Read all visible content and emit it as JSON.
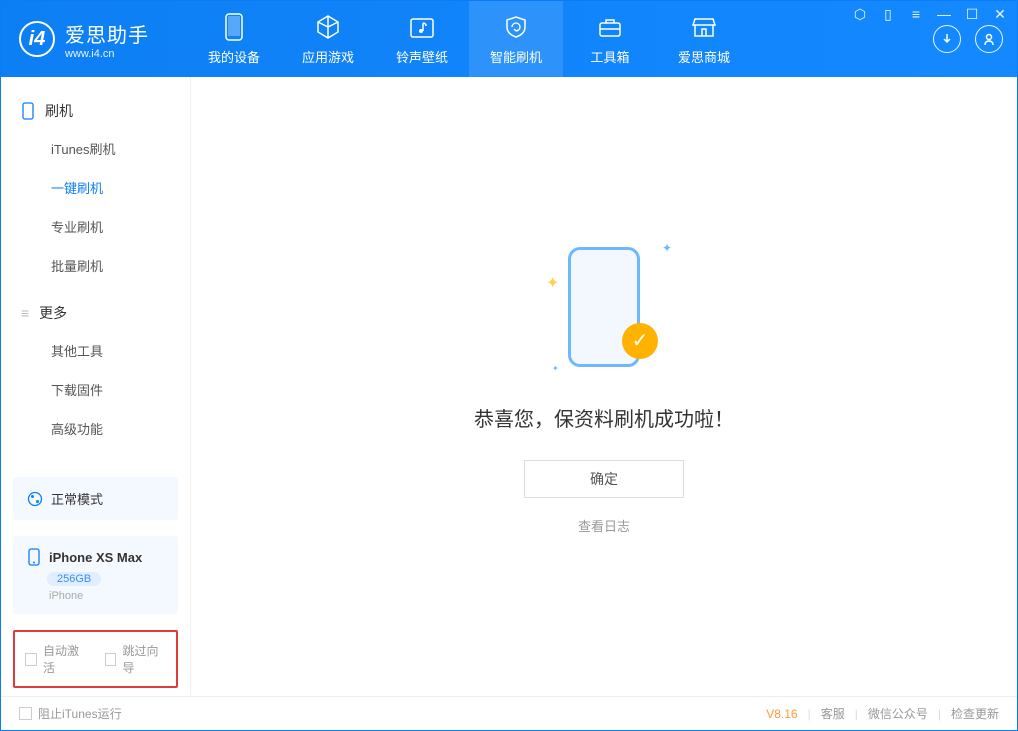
{
  "app": {
    "title": "爱思助手",
    "subtitle": "www.i4.cn"
  },
  "nav": [
    {
      "label": "我的设备"
    },
    {
      "label": "应用游戏"
    },
    {
      "label": "铃声壁纸"
    },
    {
      "label": "智能刷机"
    },
    {
      "label": "工具箱"
    },
    {
      "label": "爱思商城"
    }
  ],
  "sidebar": {
    "group1": {
      "title": "刷机",
      "items": [
        "iTunes刷机",
        "一键刷机",
        "专业刷机",
        "批量刷机"
      ]
    },
    "group2": {
      "title": "更多",
      "items": [
        "其他工具",
        "下载固件",
        "高级功能"
      ]
    }
  },
  "device": {
    "mode": "正常模式",
    "name": "iPhone XS Max",
    "capacity": "256GB",
    "type": "iPhone"
  },
  "options": {
    "auto_activate": "自动激活",
    "skip_guide": "跳过向导"
  },
  "main": {
    "success_title": "恭喜您，保资料刷机成功啦！",
    "ok_label": "确定",
    "log_link": "查看日志"
  },
  "footer": {
    "block_itunes": "阻止iTunes运行",
    "version": "V8.16",
    "links": [
      "客服",
      "微信公众号",
      "检查更新"
    ]
  }
}
